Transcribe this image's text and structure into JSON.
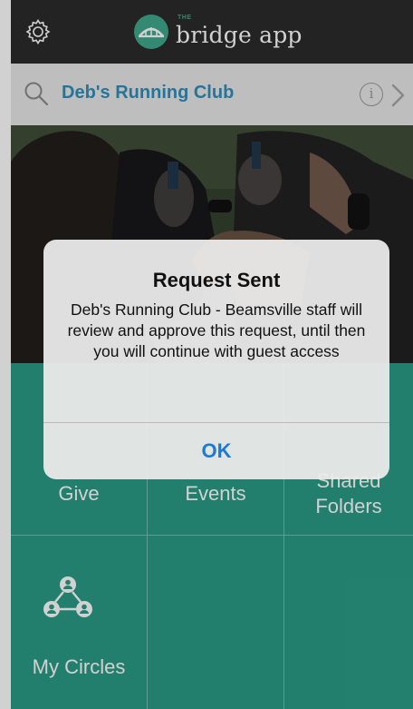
{
  "header": {
    "logo_small": "THE",
    "logo_text": "bridge app",
    "settings_icon": "gear-icon",
    "logo_icon": "bridge-arch-icon"
  },
  "club_bar": {
    "title": "Deb's Running Club",
    "search_icon": "search-icon",
    "info_icon": "info-icon",
    "info_glyph": "i",
    "chevron_icon": "chevron-right-icon",
    "title_color": "#2e8fbd"
  },
  "tiles": [
    {
      "label": "Give",
      "interactable": true
    },
    {
      "label": "Events",
      "interactable": true
    },
    {
      "label_lines": [
        "Shared",
        "Folders"
      ],
      "interactable": true
    },
    {
      "label": "My Circles",
      "icon": "circles-network-icon",
      "interactable": true
    },
    {
      "label": "",
      "interactable": false
    },
    {
      "label": "",
      "interactable": false
    }
  ],
  "alert": {
    "title": "Request Sent",
    "message": "Deb's Running Club - Beamsville staff will review and approve this request, until then you will continue with guest access",
    "ok_label": "OK",
    "ok_color": "#1a7ad6"
  },
  "colors": {
    "topbar": "#2b2b2b",
    "tiles_bg": "#2b9c86",
    "brand_green": "#3fa88a"
  }
}
